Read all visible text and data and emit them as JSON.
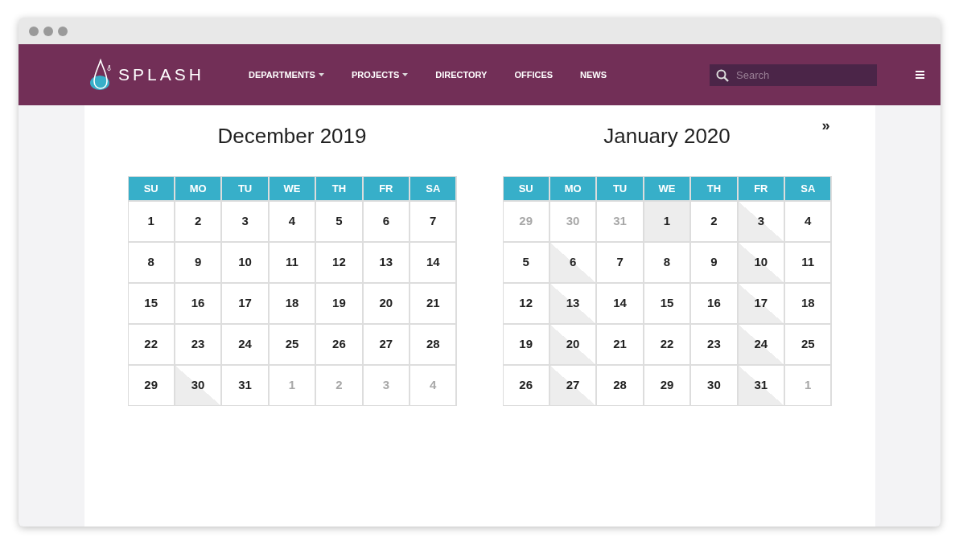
{
  "header": {
    "logo": "SPLASH",
    "nav": [
      {
        "label": "DEPARTMENTS",
        "dropdown": true
      },
      {
        "label": "PROJECTS",
        "dropdown": true
      },
      {
        "label": "DIRECTORY",
        "dropdown": false
      },
      {
        "label": "OFFICES",
        "dropdown": false
      },
      {
        "label": "NEWS",
        "dropdown": false
      }
    ],
    "search": {
      "placeholder": "Search"
    }
  },
  "next_button": "»",
  "calendars": [
    {
      "title": "December 2019",
      "weekdays": [
        "SU",
        "MO",
        "TU",
        "WE",
        "TH",
        "FR",
        "SA"
      ],
      "weeks": [
        [
          {
            "day": "1",
            "muted": false,
            "kind": "none"
          },
          {
            "day": "2",
            "muted": false,
            "kind": "none"
          },
          {
            "day": "3",
            "muted": false,
            "kind": "none"
          },
          {
            "day": "4",
            "muted": false,
            "kind": "none"
          },
          {
            "day": "5",
            "muted": false,
            "kind": "none"
          },
          {
            "day": "6",
            "muted": false,
            "kind": "none"
          },
          {
            "day": "7",
            "muted": false,
            "kind": "none"
          }
        ],
        [
          {
            "day": "8",
            "muted": false,
            "kind": "none"
          },
          {
            "day": "9",
            "muted": false,
            "kind": "none"
          },
          {
            "day": "10",
            "muted": false,
            "kind": "none"
          },
          {
            "day": "11",
            "muted": false,
            "kind": "none"
          },
          {
            "day": "12",
            "muted": false,
            "kind": "none"
          },
          {
            "day": "13",
            "muted": false,
            "kind": "none"
          },
          {
            "day": "14",
            "muted": false,
            "kind": "none"
          }
        ],
        [
          {
            "day": "15",
            "muted": false,
            "kind": "none"
          },
          {
            "day": "16",
            "muted": false,
            "kind": "none"
          },
          {
            "day": "17",
            "muted": false,
            "kind": "none"
          },
          {
            "day": "18",
            "muted": false,
            "kind": "none"
          },
          {
            "day": "19",
            "muted": false,
            "kind": "none"
          },
          {
            "day": "20",
            "muted": false,
            "kind": "none"
          },
          {
            "day": "21",
            "muted": false,
            "kind": "none"
          }
        ],
        [
          {
            "day": "22",
            "muted": false,
            "kind": "none"
          },
          {
            "day": "23",
            "muted": false,
            "kind": "none"
          },
          {
            "day": "24",
            "muted": false,
            "kind": "none"
          },
          {
            "day": "25",
            "muted": false,
            "kind": "none"
          },
          {
            "day": "26",
            "muted": false,
            "kind": "none"
          },
          {
            "day": "27",
            "muted": false,
            "kind": "none"
          },
          {
            "day": "28",
            "muted": false,
            "kind": "none"
          }
        ],
        [
          {
            "day": "29",
            "muted": false,
            "kind": "none"
          },
          {
            "day": "30",
            "muted": false,
            "kind": "half"
          },
          {
            "day": "31",
            "muted": false,
            "kind": "none"
          },
          {
            "day": "1",
            "muted": true,
            "kind": "none"
          },
          {
            "day": "2",
            "muted": true,
            "kind": "none"
          },
          {
            "day": "3",
            "muted": true,
            "kind": "none"
          },
          {
            "day": "4",
            "muted": true,
            "kind": "none"
          }
        ]
      ]
    },
    {
      "title": "January 2020",
      "weekdays": [
        "SU",
        "MO",
        "TU",
        "WE",
        "TH",
        "FR",
        "SA"
      ],
      "weeks": [
        [
          {
            "day": "29",
            "muted": true,
            "kind": "none"
          },
          {
            "day": "30",
            "muted": true,
            "kind": "none"
          },
          {
            "day": "31",
            "muted": true,
            "kind": "none"
          },
          {
            "day": "1",
            "muted": false,
            "kind": "full"
          },
          {
            "day": "2",
            "muted": false,
            "kind": "none"
          },
          {
            "day": "3",
            "muted": false,
            "kind": "half"
          },
          {
            "day": "4",
            "muted": false,
            "kind": "none"
          }
        ],
        [
          {
            "day": "5",
            "muted": false,
            "kind": "none"
          },
          {
            "day": "6",
            "muted": false,
            "kind": "half"
          },
          {
            "day": "7",
            "muted": false,
            "kind": "none"
          },
          {
            "day": "8",
            "muted": false,
            "kind": "none"
          },
          {
            "day": "9",
            "muted": false,
            "kind": "none"
          },
          {
            "day": "10",
            "muted": false,
            "kind": "half"
          },
          {
            "day": "11",
            "muted": false,
            "kind": "none"
          }
        ],
        [
          {
            "day": "12",
            "muted": false,
            "kind": "none"
          },
          {
            "day": "13",
            "muted": false,
            "kind": "half"
          },
          {
            "day": "14",
            "muted": false,
            "kind": "none"
          },
          {
            "day": "15",
            "muted": false,
            "kind": "none"
          },
          {
            "day": "16",
            "muted": false,
            "kind": "none"
          },
          {
            "day": "17",
            "muted": false,
            "kind": "half"
          },
          {
            "day": "18",
            "muted": false,
            "kind": "none"
          }
        ],
        [
          {
            "day": "19",
            "muted": false,
            "kind": "none"
          },
          {
            "day": "20",
            "muted": false,
            "kind": "half"
          },
          {
            "day": "21",
            "muted": false,
            "kind": "none"
          },
          {
            "day": "22",
            "muted": false,
            "kind": "none"
          },
          {
            "day": "23",
            "muted": false,
            "kind": "none"
          },
          {
            "day": "24",
            "muted": false,
            "kind": "half"
          },
          {
            "day": "25",
            "muted": false,
            "kind": "none"
          }
        ],
        [
          {
            "day": "26",
            "muted": false,
            "kind": "none"
          },
          {
            "day": "27",
            "muted": false,
            "kind": "half"
          },
          {
            "day": "28",
            "muted": false,
            "kind": "none"
          },
          {
            "day": "29",
            "muted": false,
            "kind": "none"
          },
          {
            "day": "30",
            "muted": false,
            "kind": "none"
          },
          {
            "day": "31",
            "muted": false,
            "kind": "half"
          },
          {
            "day": "1",
            "muted": true,
            "kind": "none"
          }
        ]
      ]
    }
  ]
}
